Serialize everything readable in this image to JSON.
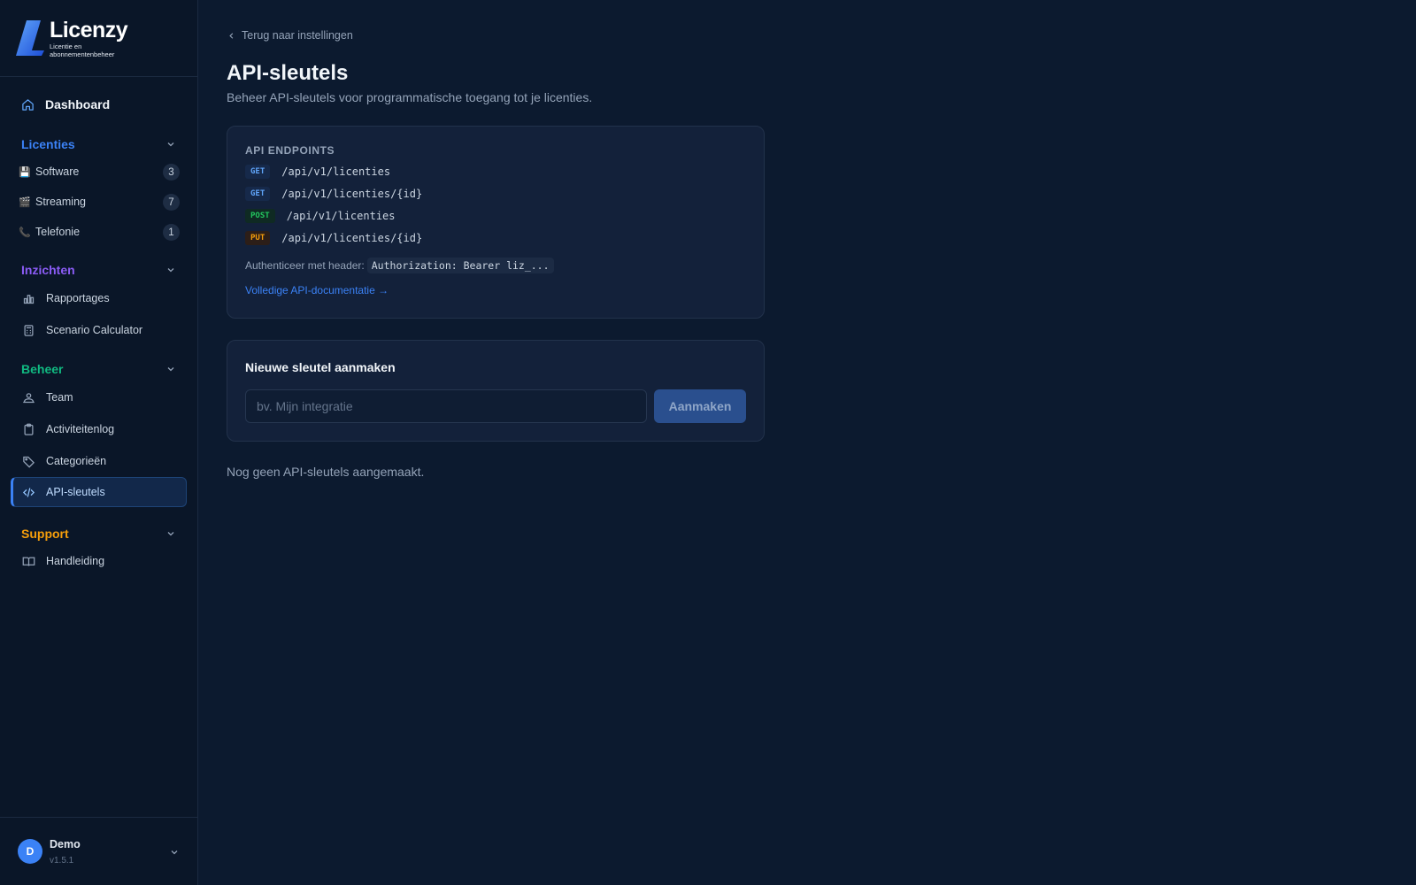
{
  "brand": {
    "name": "Licenzy",
    "subtitle": "Licentie en abonnementenbeheer",
    "accent": "#3b82f6"
  },
  "sidebar": {
    "dashboard": {
      "label": "Dashboard",
      "icon": "home-icon"
    },
    "groups": [
      {
        "label": "Licenties",
        "color": "#3b82f6",
        "items": [
          {
            "label": "Software",
            "emoji": "💾",
            "count": "3"
          },
          {
            "label": "Streaming",
            "emoji": "🎬",
            "count": "7"
          },
          {
            "label": "Telefonie",
            "emoji": "📞",
            "count": "1"
          }
        ]
      },
      {
        "label": "Inzichten",
        "color": "#8b5cf6",
        "items": [
          {
            "label": "Rapportages",
            "icon": "bar-chart-icon"
          },
          {
            "label": "Scenario Calculator",
            "icon": "calculator-icon"
          }
        ]
      },
      {
        "label": "Beheer",
        "color": "#10b981",
        "items": [
          {
            "label": "Team",
            "icon": "team-icon"
          },
          {
            "label": "Activiteitenlog",
            "icon": "clipboard-icon"
          },
          {
            "label": "Categorieën",
            "icon": "tag-icon"
          },
          {
            "label": "API-sleutels",
            "icon": "code-icon",
            "active": true
          }
        ]
      },
      {
        "label": "Support",
        "color": "#f59e0b",
        "items": [
          {
            "label": "Handleiding",
            "icon": "book-icon"
          }
        ]
      }
    ],
    "user": {
      "initial": "D",
      "name": "Demo",
      "version": "v1.5.1"
    }
  },
  "main": {
    "back_label": "Terug naar instellingen",
    "title": "API-sleutels",
    "description": "Beheer API-sleutels voor programmatische toegang tot je licenties.",
    "endpoints": {
      "label": "API ENDPOINTS",
      "items": [
        {
          "method": "GET",
          "path": "/api/v1/licenties"
        },
        {
          "method": "GET",
          "path": "/api/v1/licenties/{id}"
        },
        {
          "method": "POST",
          "path": "/api/v1/licenties"
        },
        {
          "method": "PUT",
          "path": "/api/v1/licenties/{id}"
        }
      ],
      "auth_label": "Authenticeer met header:",
      "auth_code": "Authorization: Bearer liz_...",
      "docs_link": "Volledige API-documentatie →"
    },
    "new_key": {
      "title": "Nieuwe sleutel aanmaken",
      "placeholder": "bv. Mijn integratie",
      "value": "",
      "button": "Aanmaken"
    },
    "empty_state": "Nog geen API-sleutels aangemaakt."
  }
}
